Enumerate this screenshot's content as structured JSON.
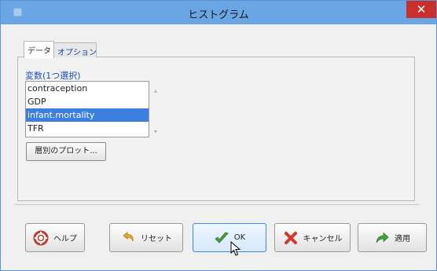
{
  "window": {
    "title": "ヒストグラム",
    "close_glyph": "✕",
    "titlebar_color": "#6aa6e4",
    "close_color": "#c9302c"
  },
  "tabs": [
    {
      "label": "データ",
      "active": true
    },
    {
      "label": "オプション",
      "active": false
    }
  ],
  "variables": {
    "label": "変数(1つ選択)",
    "items": [
      {
        "label": "contraception",
        "selected": false
      },
      {
        "label": "GDP",
        "selected": false
      },
      {
        "label": "infant.mortality",
        "selected": true
      },
      {
        "label": "TFR",
        "selected": false
      }
    ]
  },
  "group_button": {
    "label": "層別のプロット..."
  },
  "buttons": {
    "help": {
      "label": "ヘルプ",
      "icon": "lifebuoy-icon"
    },
    "reset": {
      "label": "リセット",
      "icon": "undo-arrow-icon"
    },
    "ok": {
      "label": "OK",
      "icon": "checkmark-icon"
    },
    "cancel": {
      "label": "キャンセル",
      "icon": "red-x-icon"
    },
    "apply": {
      "label": "適用",
      "icon": "green-arrow-icon"
    }
  },
  "colors": {
    "selection": "#3d7fe0",
    "variable_label": "#1a4fb8"
  }
}
